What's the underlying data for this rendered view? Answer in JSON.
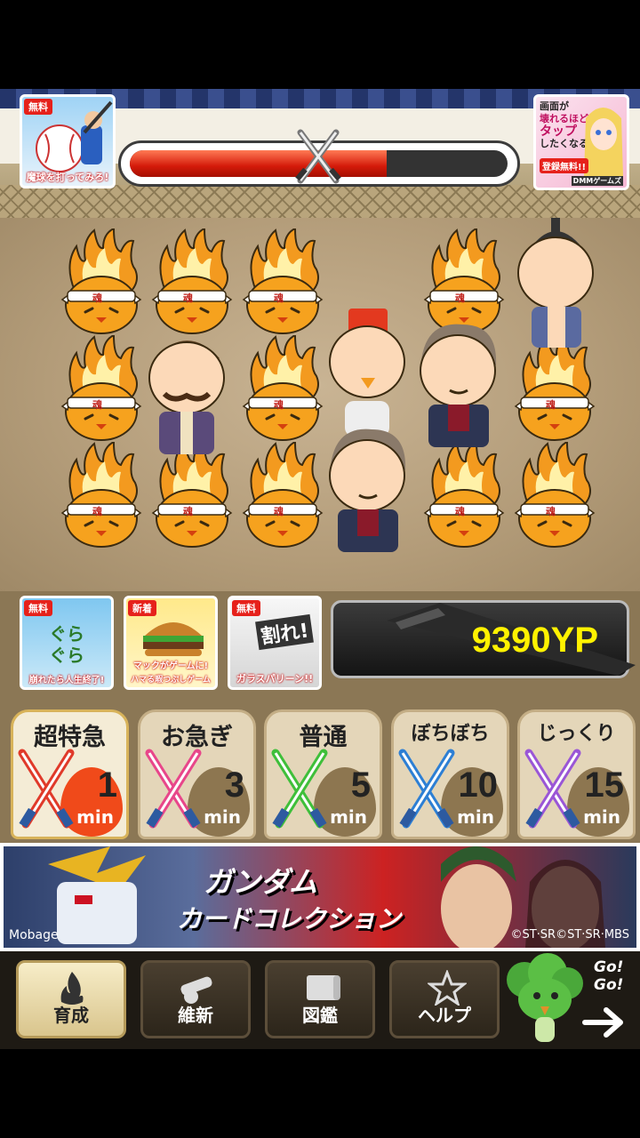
{
  "header": {
    "left_ad": {
      "tag": "無料",
      "caption": "魔球を打ってみろ!"
    },
    "right_ad": {
      "line1": "画面が",
      "line2": "壊れるほど",
      "line3": "タップ",
      "line4": "したくなる!",
      "badge": "登録無料!!",
      "brand": "DMMゲームズ"
    },
    "progress": 0.68
  },
  "mini_ads": [
    {
      "tag": "無料",
      "caption": "崩れたら人生終了!",
      "art": "ぐら ぐら"
    },
    {
      "tag": "新着",
      "caption1": "マックがゲームに!",
      "caption2": "ハマる暇つぶしゲーム"
    },
    {
      "tag": "無料",
      "caption": "ガラスパリーン!!",
      "art": "割れ!"
    }
  ],
  "spirit_label": "魂",
  "points": "9390YP",
  "speeds": [
    {
      "label": "超特急",
      "number": "1",
      "unit": "min",
      "blade": "#e03a2a"
    },
    {
      "label": "お急ぎ",
      "number": "3",
      "unit": "min",
      "blade": "#e8468a"
    },
    {
      "label": "普通",
      "number": "5",
      "unit": "min",
      "blade": "#3fbf3a"
    },
    {
      "label": "ぼちぼち",
      "number": "10",
      "unit": "min",
      "blade": "#2d7fd4"
    },
    {
      "label": "じっくり",
      "number": "15",
      "unit": "min",
      "blade": "#9a56d6"
    }
  ],
  "banner": {
    "title": "ガンダム",
    "subtitle": "カードコレクション",
    "provider": "Mobage",
    "copyright": "©ST·SR©ST·SR·MBS"
  },
  "nav": [
    {
      "label": "育成",
      "icon": "flame-icon"
    },
    {
      "label": "維新",
      "icon": "cannon-icon"
    },
    {
      "label": "図鑑",
      "icon": "scroll-icon"
    },
    {
      "label": "ヘルプ",
      "icon": "star-icon"
    }
  ],
  "mascot": {
    "text1": "Go!",
    "text2": "Go!"
  }
}
